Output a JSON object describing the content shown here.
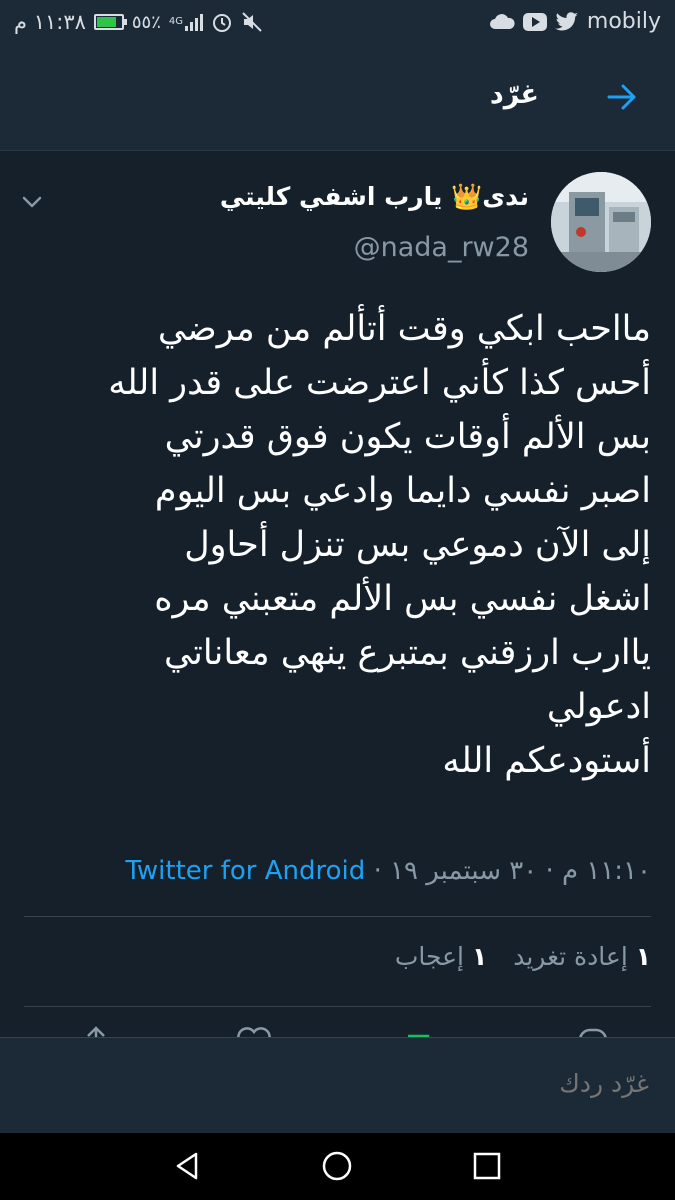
{
  "status_bar": {
    "time": "١١:٣٨ م",
    "battery": "٥٥٪",
    "network": "4G",
    "carrier": "mobily",
    "colors": {
      "battery_fill": "#2fc447"
    },
    "icons": [
      "mute-icon",
      "alarm-icon",
      "signal-icon",
      "battery-icon",
      "twitter-bird-icon",
      "youtube-icon",
      "cloud-icon"
    ]
  },
  "header": {
    "title": "غرّد",
    "back_icon": "arrow-right-icon"
  },
  "tweet": {
    "display_name": "ندى👑 يارب اشفي كليتي",
    "handle": "@nada_rw28",
    "text_lines": [
      "مااحب ابكي وقت أتألم من مرضي",
      "أحس كذا كأني اعترضت على قدر الله",
      "بس الألم أوقات يكون فوق قدرتي",
      "اصبر نفسي دايما وادعي بس اليوم",
      "إلى الآن دموعي بس تنزل أحاول",
      "اشغل نفسي بس الألم متعبني مره",
      "ياارب ارزقني بمتبرع ينهي معاناتي",
      "ادعولي",
      "أستودعكم الله"
    ],
    "meta": {
      "time": "١١:١٠ م",
      "date": "٣٠ سبتمبر ١٩",
      "separator": "·",
      "source": "Twitter for Android"
    },
    "stats": {
      "retweets_count": "١",
      "retweets_label": "إعادة تغريد",
      "likes_count": "١",
      "likes_label": "إعجاب"
    }
  },
  "reply": {
    "placeholder": "غرّد ردك"
  },
  "colors": {
    "background": "#15202b",
    "header_bg": "#1c2a38",
    "accent": "#1da1f2",
    "secondary_text": "#8899a6",
    "retweet_green": "#17bf63"
  }
}
